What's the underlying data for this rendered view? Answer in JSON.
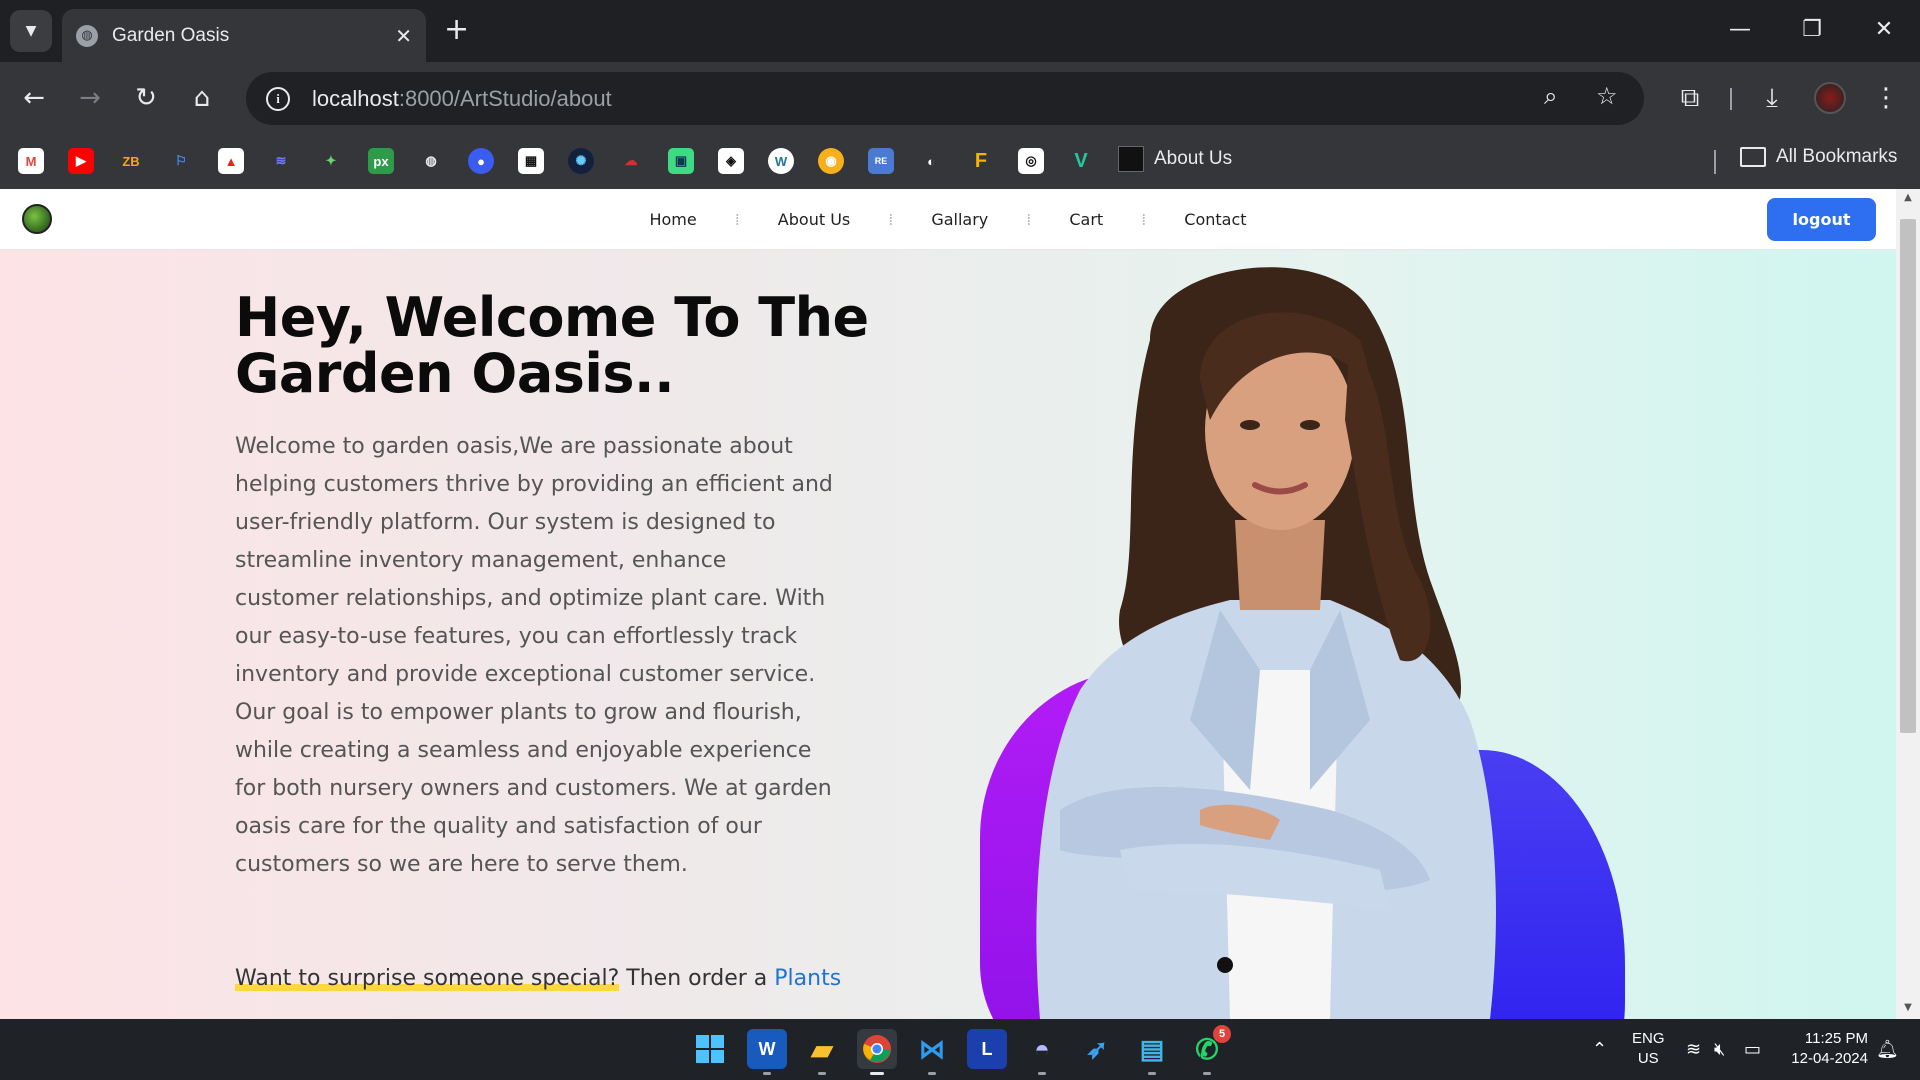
{
  "browser": {
    "tab_title": "Garden Oasis",
    "url_host": "localhost",
    "url_path": ":8000/ArtStudio/about",
    "bookmarks_about": "About Us",
    "bookmarks_all": "All Bookmarks",
    "bookmark_icons": [
      "gmail-icon",
      "youtube-icon",
      "zb-icon",
      "flag-icon",
      "red-logo-icon",
      "swirl-icon",
      "bird-icon",
      "px-icon",
      "globe-icon",
      "chrome-ext-icon",
      "qr-icon",
      "gear-node-icon",
      "cloud-icon",
      "android-icon",
      "codepen-icon",
      "wordpress-icon",
      "orange-icon",
      "repo-icon",
      "github-icon",
      "f-icon",
      "camera-icon",
      "v-icon"
    ]
  },
  "site": {
    "nav": {
      "items": [
        "Home",
        "About Us",
        "Gallary",
        "Cart",
        "Contact"
      ],
      "logout": "logout"
    },
    "hero": {
      "title": "Hey, Welcome To The Garden Oasis..",
      "paragraph": "Welcome to garden oasis,We are passionate about helping customers thrive by providing an efficient and user-friendly platform. Our system is designed to streamline inventory management, enhance customer relationships, and optimize plant care. With our easy-to-use features, you can effortlessly track inventory and provide exceptional customer service. Our goal is to empower plants to grow and flourish, while creating a seamless and enjoyable experience for both nursery owners and customers. We at garden oasis care for the quality and satisfaction of our customers so we are here to serve them.",
      "cta_highlight": "Want to surprise someone special?",
      "cta_text": " Then order a ",
      "cta_link": "Plants"
    }
  },
  "taskbar": {
    "apps": [
      "windows-start",
      "word",
      "file-explorer",
      "chrome",
      "vscode",
      "l-app",
      "eclipse",
      "dart-app",
      "notepad",
      "whatsapp"
    ],
    "whatsapp_badge": "5",
    "lang_line1": "ENG",
    "lang_line2": "US",
    "time": "11:25 PM",
    "date": "12-04-2024"
  }
}
